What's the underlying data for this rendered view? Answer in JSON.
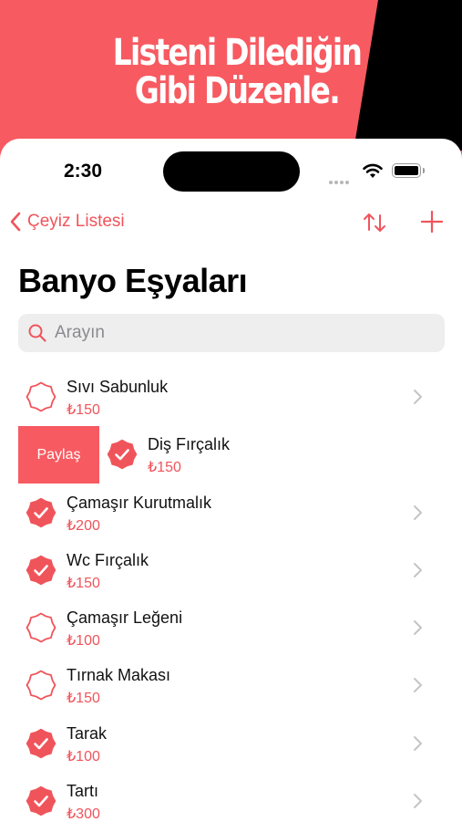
{
  "banner": {
    "line1": "Listeni Dilediğin",
    "line2": "Gibi Düzenle."
  },
  "status": {
    "time": "2:30"
  },
  "nav": {
    "back_label": "Çeyiz Listesi"
  },
  "page": {
    "title": "Banyo Eşyaları"
  },
  "search": {
    "placeholder": "Arayın"
  },
  "share_label": "Paylaş",
  "colors": {
    "accent": "#f0545b",
    "banner": "#f75a61"
  },
  "items": [
    {
      "name": "Sıvı Sabunluk",
      "price": "₺150",
      "checked": false
    },
    {
      "name": "Diş Fırçalık",
      "price": "₺150",
      "checked": true
    },
    {
      "name": "Çamaşır Kurutmalık",
      "price": "₺200",
      "checked": true
    },
    {
      "name": "Wc Fırçalık",
      "price": "₺150",
      "checked": true
    },
    {
      "name": "Çamaşır Leğeni",
      "price": "₺100",
      "checked": false
    },
    {
      "name": "Tırnak Makası",
      "price": "₺150",
      "checked": false
    },
    {
      "name": "Tarak",
      "price": "₺100",
      "checked": true
    },
    {
      "name": "Tartı",
      "price": "₺300",
      "checked": true
    }
  ]
}
